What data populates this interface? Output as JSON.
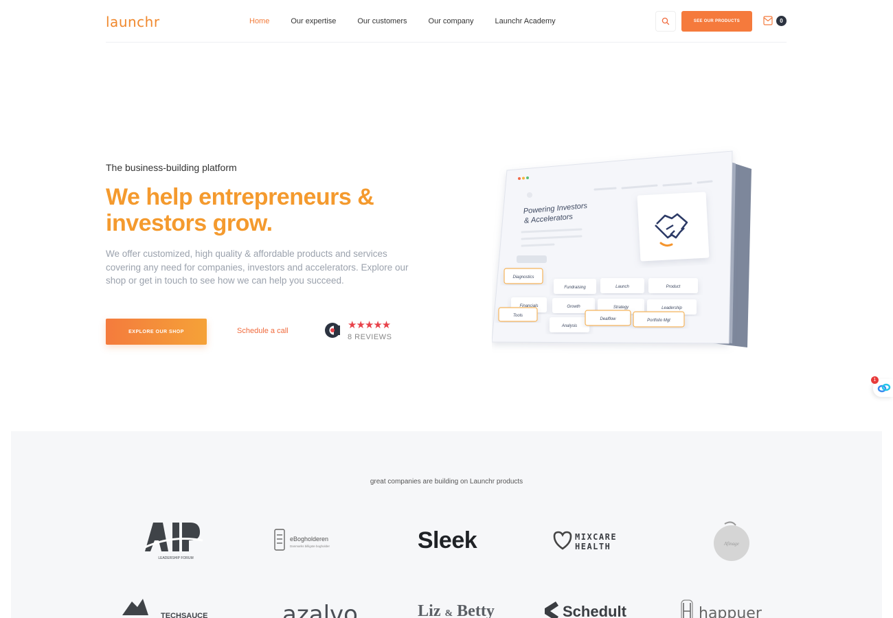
{
  "header": {
    "logo": "launchr",
    "nav": [
      {
        "label": "Home",
        "active": true
      },
      {
        "label": "Our expertise",
        "active": false
      },
      {
        "label": "Our customers",
        "active": false
      },
      {
        "label": "Our company",
        "active": false
      },
      {
        "label": "Launchr Academy",
        "active": false
      }
    ],
    "cta": "SEE OUR PRODUCTS",
    "search_icon": "search-icon",
    "mail_icon": "mail-icon",
    "cart_count": "0"
  },
  "hero": {
    "eyebrow": "The business-building platform",
    "title": "We help entrepreneurs & investors grow.",
    "description": "We offer customized, high quality & affordable products and services covering any need for companies, investors and accelerators. Explore our shop or get in touch to see how we can help you succeed.",
    "primary_button": "EXPLORE OUR SHOP",
    "secondary_link": "Schedule a call",
    "rating_stars": "★★★★★",
    "reviews": "8 REVIEWS"
  },
  "illustration": {
    "heading_line1": "Powering Investors",
    "heading_line2": "& Accelerators",
    "tags": [
      "Diagnostics",
      "Fundraising",
      "Launch",
      "Product",
      "Financials",
      "Growth",
      "Strategy",
      "Leadership",
      "Tools",
      "Analysis",
      "Dealflow",
      "Portfolio Mgt"
    ]
  },
  "widget": {
    "badge": "1"
  },
  "customers": {
    "title": "great companies are building on Launchr products",
    "logos": [
      {
        "name": "AIP",
        "sub": "LEADERSHIP FORUM"
      },
      {
        "name": "eBogholderen",
        "sub": "Danmarks billigste bogholder"
      },
      {
        "name": "Sleek"
      },
      {
        "name": "MIXCARE",
        "sub": "HEALTH"
      },
      {
        "name": "Afinage"
      },
      {
        "name": "TECHSAUCE"
      },
      {
        "name": "azalvo"
      },
      {
        "name": "Liz",
        "amp": "&",
        "name2": "Betty"
      },
      {
        "name": "Schedult"
      },
      {
        "name": "happuer"
      }
    ]
  },
  "colors": {
    "accent": "#f49a2e",
    "cta": "#f57a3c",
    "link": "#f06a3c",
    "star": "#e8424a"
  }
}
